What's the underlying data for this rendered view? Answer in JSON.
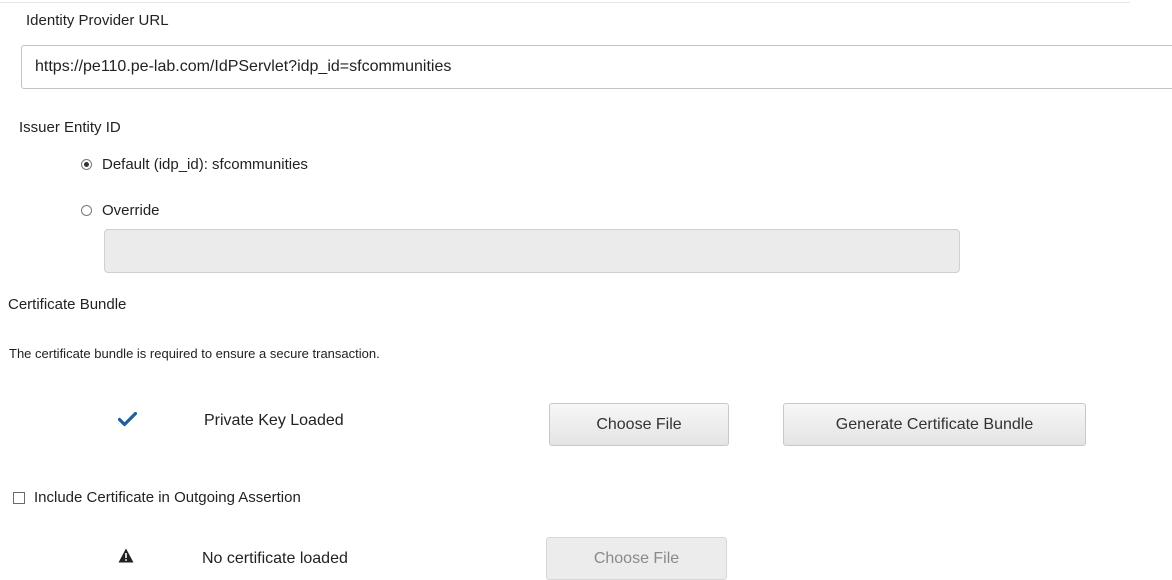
{
  "identity_provider": {
    "label": "Identity Provider URL",
    "url_value": "https://pe110.pe-lab.com/IdPServlet?idp_id=sfcommunities"
  },
  "issuer": {
    "label": "Issuer Entity ID",
    "default_option": "Default (idp_id): sfcommunities",
    "override_option": "Override",
    "override_value": "",
    "selected": "default"
  },
  "certificate_bundle": {
    "heading": "Certificate Bundle",
    "description": "The certificate bundle is required to ensure a secure transaction.",
    "private_key_icon": "checkmark-icon",
    "private_key_status": "Private Key Loaded",
    "choose_file_label": "Choose File",
    "generate_label": "Generate Certificate Bundle"
  },
  "outgoing_assertion": {
    "checkbox_label": "Include Certificate in Outgoing Assertion",
    "checked": false,
    "status_icon": "warning-icon",
    "status_text": "No certificate loaded",
    "choose_file_label": "Choose File"
  },
  "colors": {
    "check_blue": "#1f5f9c",
    "warning_dark": "#222222"
  }
}
